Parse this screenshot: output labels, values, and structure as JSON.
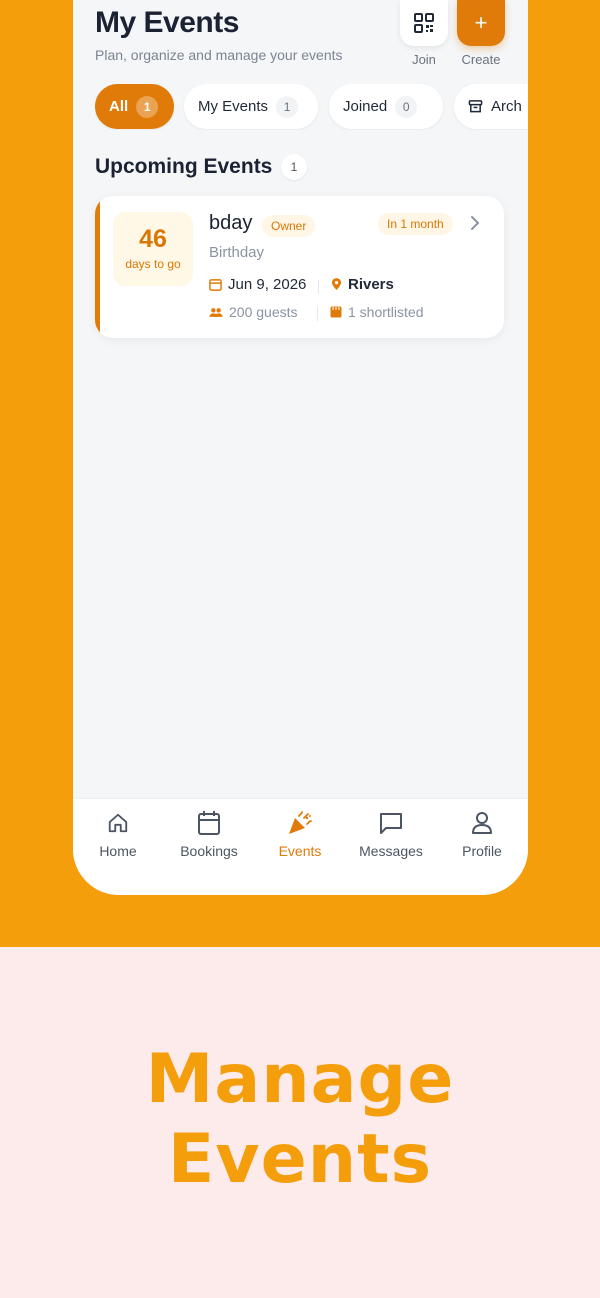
{
  "header": {
    "title": "My Events",
    "subtitle": "Plan, organize and manage your events",
    "join_label": "Join",
    "create_label": "Create",
    "create_icon": "+"
  },
  "tabs": [
    {
      "label": "All",
      "count": "1",
      "active": true
    },
    {
      "label": "My Events",
      "count": "1"
    },
    {
      "label": "Joined",
      "count": "0"
    },
    {
      "label": "Archived",
      "visible_text": "Arch"
    }
  ],
  "section": {
    "title": "Upcoming Events",
    "count": "1"
  },
  "events": [
    {
      "days": "46",
      "days_label": "days to go",
      "name": "bday",
      "role": "Owner",
      "when": "In 1 month",
      "type": "Birthday",
      "date": "Jun 9, 2026",
      "location": "Rivers",
      "guests": "200 guests",
      "shortlisted": "1 shortlisted"
    }
  ],
  "nav": {
    "home": "Home",
    "bookings": "Bookings",
    "events": "Events",
    "messages": "Messages",
    "profile": "Profile",
    "active": "events"
  },
  "promo": {
    "line1": "Manage",
    "line2": "Events"
  },
  "colors": {
    "primary": "#e07b0a",
    "background_top": "#f59e0b",
    "background_bottom": "#fdeaea"
  }
}
